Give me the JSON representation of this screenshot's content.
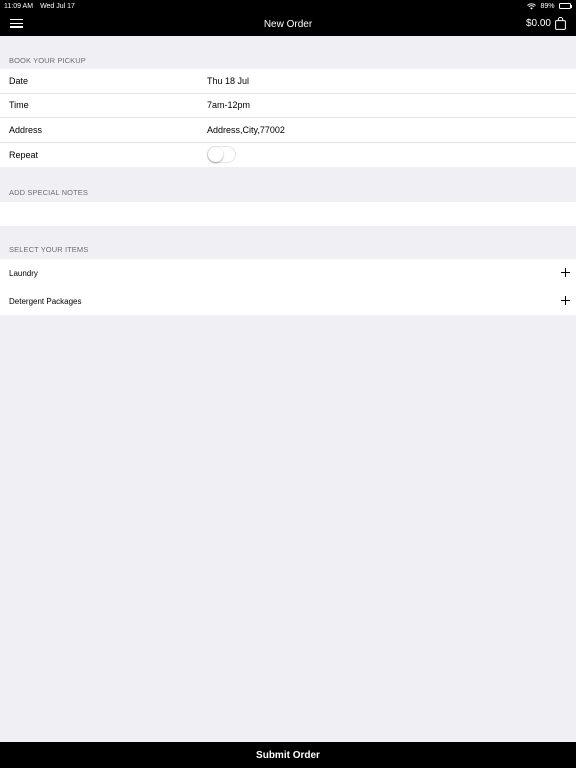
{
  "status_bar": {
    "time": "11:09 AM",
    "date": "Wed Jul 17",
    "battery": "89%",
    "battery_level": 0.89
  },
  "nav": {
    "title": "New Order",
    "cart_total": "$0.00"
  },
  "pickup": {
    "header": "BOOK YOUR PICKUP",
    "rows": [
      {
        "label": "Date",
        "value": "Thu 18 Jul"
      },
      {
        "label": "Time",
        "value": "7am-12pm"
      },
      {
        "label": "Address",
        "value": "Address,City,77002"
      },
      {
        "label": "Repeat",
        "toggle_on": false
      }
    ]
  },
  "notes": {
    "header": "ADD SPECIAL NOTES",
    "value": ""
  },
  "items": {
    "header": "SELECT YOUR ITEMS",
    "list": [
      {
        "label": "Laundry"
      },
      {
        "label": "Detergent Packages"
      }
    ]
  },
  "submit": {
    "label": "Submit Order"
  },
  "colors": {
    "bar_bg": "#000000",
    "page_bg": "#efeff4",
    "section_text": "#6d6d72"
  },
  "icons": [
    "menu-icon",
    "shopping-bag-icon",
    "plus-icon",
    "wifi-icon",
    "battery-icon"
  ]
}
